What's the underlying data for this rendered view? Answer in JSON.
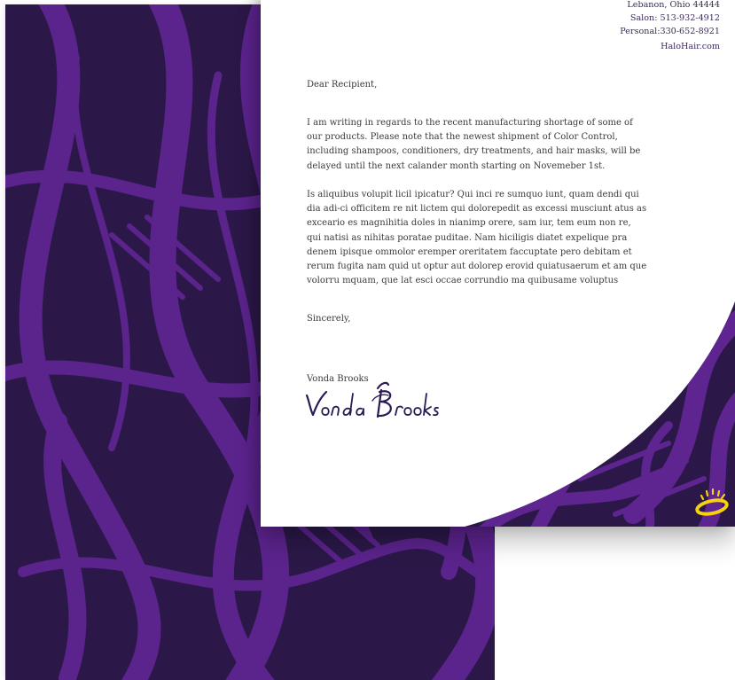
{
  "letterhead": {
    "city_line": "Lebanon, Ohio 44444",
    "salon_phone": "Salon: 513-932-4912",
    "personal_phone": "Personal:330-652-8921",
    "website": "HaloHair.com"
  },
  "letter": {
    "salutation": "Dear Recipient,",
    "paragraph_1": "I am writing in regards to the recent manufacturing shortage of some of our products. Please note that the newest shipment of Color Control, including shampoos, conditioners, dry treatments, and hair masks, will be delayed until the next calander month starting on Novemeber 1st.",
    "paragraph_2": "Is aliquibus volupit licil ipicatur? Qui inci re sumquo iunt, quam dendi qui dia adi-ci officitem re nit lictem qui dolorepedit as excessi musciunt atus as exceario es magnihitia doles in nianimp orere, sam iur, tem eum non re, qui natisi as nihitas poratae puditae. Nam hiciligis diatet expelique pra denem ipisque ommolor eremper oreritatem faccuptate pero debitam et rerum fugita nam quid ut optur aut dolorep erovid quiatusaerum et am que volorru mquam, que lat esci occae corrundio ma quibusame voluptus",
    "closing": "Sincerely,",
    "signer_name": "Vonda Brooks",
    "signature_text": "Vonda Brooks"
  },
  "colors": {
    "pattern_dark": "#2b1848",
    "pattern_light": "#6a2a9c",
    "logo_yellow": "#f5d20c",
    "signature_ink": "#2a1a55"
  },
  "icons": {
    "logo": "halo-ring-icon"
  }
}
